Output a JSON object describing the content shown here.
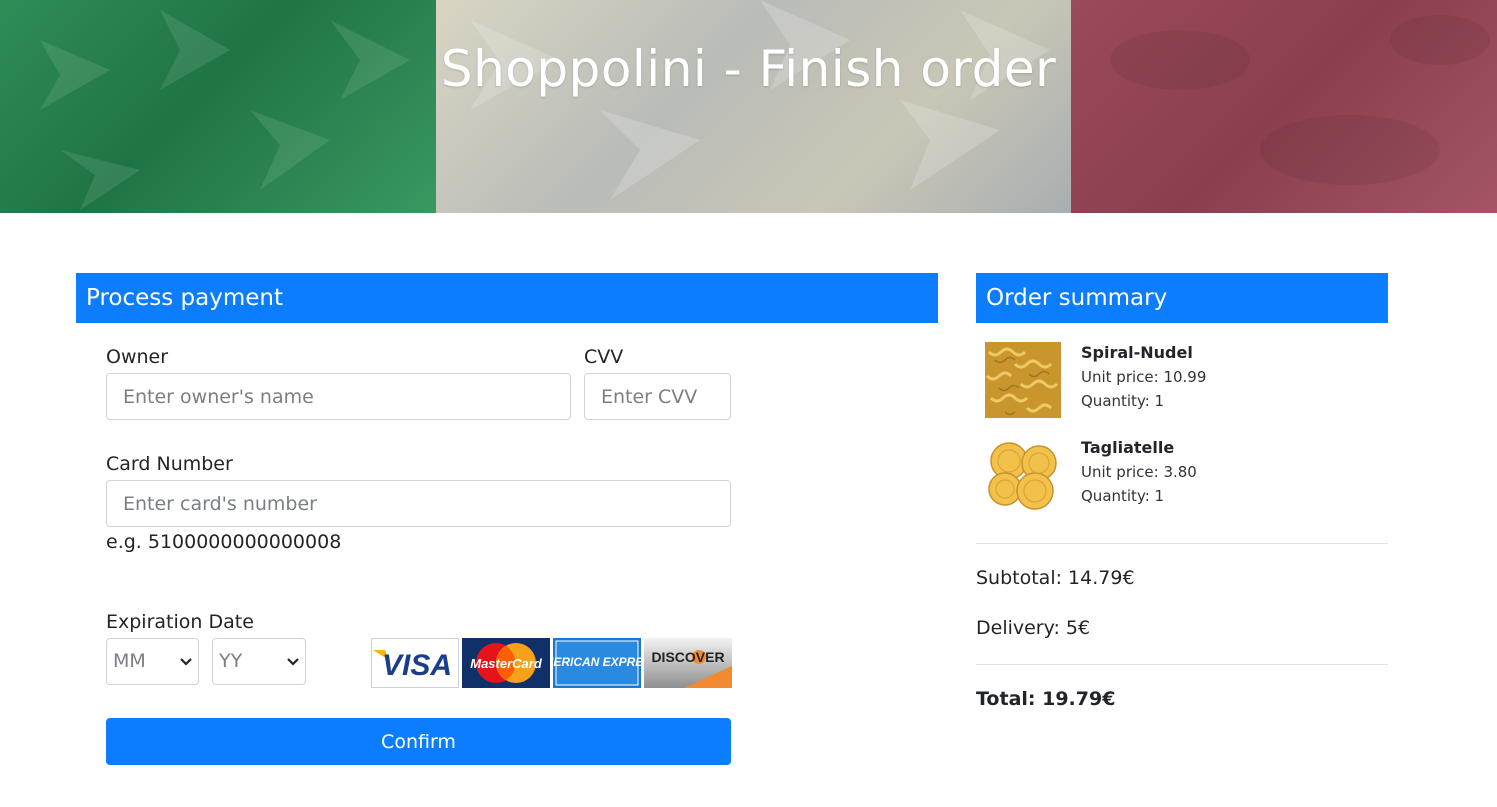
{
  "hero": {
    "title": "Shoppolini - Finish order",
    "colors": {
      "green": "#1f7446",
      "white": "#c9c6b6",
      "red": "#8b3f4d"
    }
  },
  "payment": {
    "header": "Process payment",
    "owner_label": "Owner",
    "owner_placeholder": "Enter owner's name",
    "cvv_label": "CVV",
    "cvv_placeholder": "Enter CVV",
    "card_label": "Card Number",
    "card_placeholder": "Enter card's number",
    "card_hint": "e.g. 5100000000000008",
    "expiration_label": "Expiration Date",
    "month_placeholder": "MM",
    "year_placeholder": "YY",
    "card_brands": [
      "VISA",
      "MasterCard",
      "AMERICAN EXPRESS",
      "DISCOVER"
    ],
    "confirm_label": "Confirm",
    "accent_color": "#0d7dff"
  },
  "summary": {
    "header": "Order summary",
    "items": [
      {
        "name": "Spiral-Nudel",
        "unit_price": "Unit price: 10.99",
        "quantity": "Quantity: 1",
        "icon": "fusilli-pasta-image"
      },
      {
        "name": "Tagliatelle",
        "unit_price": "Unit price: 3.80",
        "quantity": "Quantity: 1",
        "icon": "tagliatelle-pasta-image"
      }
    ],
    "subtotal": "Subtotal: 14.79€",
    "delivery": "Delivery: 5€",
    "total": "Total: 19.79€"
  }
}
